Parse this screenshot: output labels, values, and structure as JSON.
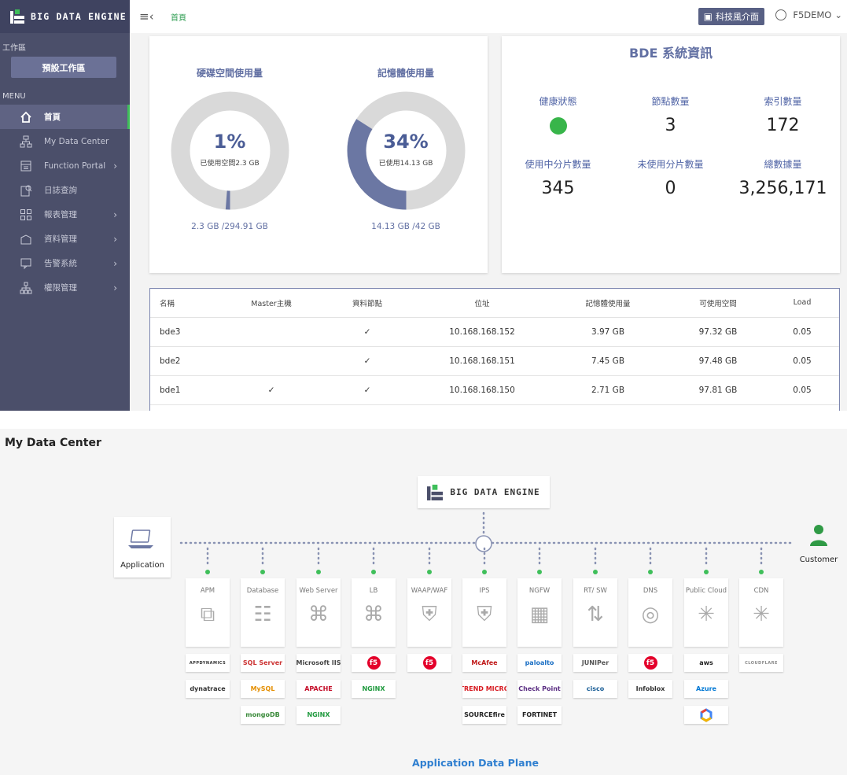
{
  "brand": {
    "name": "BIG DATA ENGINE"
  },
  "sidebar": {
    "workspace_section": "工作區",
    "workspace_button": "預設工作區",
    "menu_section": "MENU",
    "items": [
      {
        "label": "首頁",
        "icon": "home-icon"
      },
      {
        "label": "My Data Center",
        "icon": "network-icon"
      },
      {
        "label": "Function Portal",
        "icon": "portal-icon"
      },
      {
        "label": "日誌查詢",
        "icon": "log-search-icon"
      },
      {
        "label": "報表管理",
        "icon": "report-icon"
      },
      {
        "label": "資料管理",
        "icon": "data-icon"
      },
      {
        "label": "告警系統",
        "icon": "alert-icon"
      },
      {
        "label": "權限管理",
        "icon": "permission-icon"
      }
    ]
  },
  "topbar": {
    "breadcrumb": "首頁",
    "tech_button": "科技風介面",
    "user": "F5DEMO"
  },
  "usage": {
    "disk": {
      "title": "硬碟空間使用量",
      "percent_label": "1%",
      "percent": 0.01,
      "used_label": "已使用空間2.3 GB",
      "total": "2.3 GB /294.91 GB"
    },
    "memory": {
      "title": "記憶體使用量",
      "percent_label": "34%",
      "percent": 0.34,
      "used_label": "已使用14.13 GB",
      "total": "14.13 GB /42 GB"
    }
  },
  "system_info": {
    "title": "BDE 系統資訊",
    "health_label": "健康狀態",
    "nodes_label": "節點數量",
    "nodes": "3",
    "index_label": "索引數量",
    "index": "172",
    "shards_active_label": "使用中分片數量",
    "shards_active": "345",
    "shards_unused_label": "未使用分片數量",
    "shards_unused": "0",
    "docs_label": "總數據量",
    "docs": "3,256,171",
    "health_color": "#38b54a"
  },
  "table": {
    "headers": [
      "名稱",
      "Master主機",
      "資料節點",
      "位址",
      "記憶體使用量",
      "可使用空間",
      "Load"
    ],
    "rows": [
      [
        "bde3",
        "",
        "✓",
        "10.168.168.152",
        "3.97 GB",
        "97.32 GB",
        "0.05"
      ],
      [
        "bde2",
        "",
        "✓",
        "10.168.168.151",
        "7.45 GB",
        "97.48 GB",
        "0.05"
      ],
      [
        "bde1",
        "✓",
        "✓",
        "10.168.168.150",
        "2.71 GB",
        "97.81 GB",
        "0.05"
      ]
    ]
  },
  "diagram": {
    "title": "My Data Center",
    "center_label": "BIG DATA ENGINE",
    "application_label": "Application",
    "customer_label": "Customer",
    "plane_label": "Application Data Plane",
    "categories": [
      {
        "label": "APM",
        "vendors": [
          "APPDYNAMICS",
          "dynatrace"
        ]
      },
      {
        "label": "Database",
        "vendors": [
          "SQL Server",
          "MySQL",
          "mongoDB"
        ]
      },
      {
        "label": "Web Server",
        "vendors": [
          "Microsoft IIS",
          "APACHE",
          "NGINX"
        ]
      },
      {
        "label": "LB",
        "vendors": [
          "f5",
          "NGINX"
        ]
      },
      {
        "label": "WAAP/WAF",
        "vendors": [
          "f5"
        ]
      },
      {
        "label": "IPS",
        "vendors": [
          "McAfee",
          "TREND MICRO",
          "SOURCEfire"
        ]
      },
      {
        "label": "NGFW",
        "vendors": [
          "paloalto",
          "Check Point",
          "FORTINET"
        ]
      },
      {
        "label": "RT/ SW",
        "vendors": [
          "JUNIPer",
          "cisco"
        ]
      },
      {
        "label": "DNS",
        "vendors": [
          "f5",
          "Infoblox"
        ]
      },
      {
        "label": "Public Cloud",
        "vendors": [
          "aws",
          "Azure",
          ""
        ]
      },
      {
        "label": "CDN",
        "vendors": [
          "CLOUDFLARE"
        ]
      }
    ]
  }
}
